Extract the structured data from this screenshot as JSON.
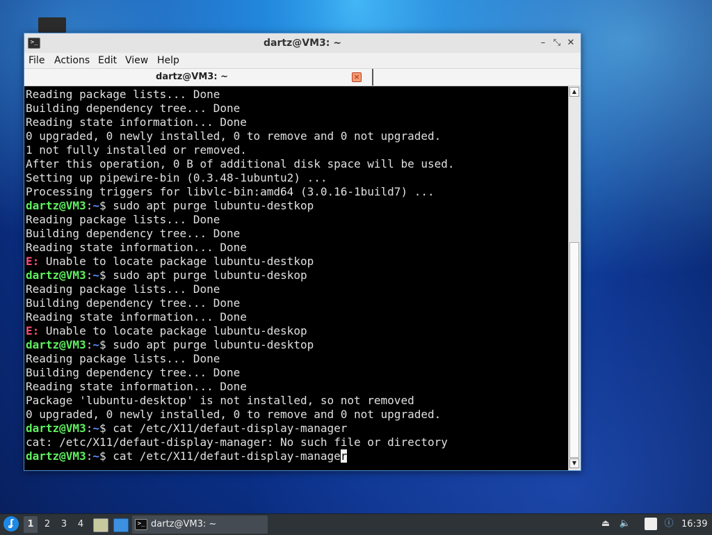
{
  "window": {
    "title": "dartz@VM3: ~",
    "minimize": "–",
    "maximize": "⤡",
    "close": "✕"
  },
  "menu": [
    "File",
    "Actions",
    "Edit",
    "View",
    "Help"
  ],
  "tab": {
    "label": "dartz@VM3: ~",
    "close": "×"
  },
  "terminal": {
    "lines": [
      {
        "type": "out",
        "text": "Reading package lists... Done"
      },
      {
        "type": "out",
        "text": "Building dependency tree... Done"
      },
      {
        "type": "out",
        "text": "Reading state information... Done"
      },
      {
        "type": "out",
        "text": "0 upgraded, 0 newly installed, 0 to remove and 0 not upgraded."
      },
      {
        "type": "out",
        "text": "1 not fully installed or removed."
      },
      {
        "type": "out",
        "text": "After this operation, 0 B of additional disk space will be used."
      },
      {
        "type": "out",
        "text": "Setting up pipewire-bin (0.3.48-1ubuntu2) ..."
      },
      {
        "type": "out",
        "text": "Processing triggers for libvlc-bin:amd64 (3.0.16-1build7) ..."
      },
      {
        "type": "cmd",
        "user": "dartz@VM3",
        "sep": ":",
        "path": "~",
        "sym": "$ ",
        "text": "sudo apt purge lubuntu-destkop"
      },
      {
        "type": "out",
        "text": "Reading package lists... Done"
      },
      {
        "type": "out",
        "text": "Building dependency tree... Done"
      },
      {
        "type": "out",
        "text": "Reading state information... Done"
      },
      {
        "type": "err",
        "prefix": "E:",
        "text": " Unable to locate package lubuntu-destkop"
      },
      {
        "type": "cmd",
        "user": "dartz@VM3",
        "sep": ":",
        "path": "~",
        "sym": "$ ",
        "text": "sudo apt purge lubuntu-deskop"
      },
      {
        "type": "out",
        "text": "Reading package lists... Done"
      },
      {
        "type": "out",
        "text": "Building dependency tree... Done"
      },
      {
        "type": "out",
        "text": "Reading state information... Done"
      },
      {
        "type": "err",
        "prefix": "E:",
        "text": " Unable to locate package lubuntu-deskop"
      },
      {
        "type": "cmd",
        "user": "dartz@VM3",
        "sep": ":",
        "path": "~",
        "sym": "$ ",
        "text": "sudo apt purge lubuntu-desktop"
      },
      {
        "type": "out",
        "text": "Reading package lists... Done"
      },
      {
        "type": "out",
        "text": "Building dependency tree... Done"
      },
      {
        "type": "out",
        "text": "Reading state information... Done"
      },
      {
        "type": "out",
        "text": "Package 'lubuntu-desktop' is not installed, so not removed"
      },
      {
        "type": "out",
        "text": "0 upgraded, 0 newly installed, 0 to remove and 0 not upgraded."
      },
      {
        "type": "cmd",
        "user": "dartz@VM3",
        "sep": ":",
        "path": "~",
        "sym": "$ ",
        "text": "cat /etc/X11/defaut-display-manager"
      },
      {
        "type": "out",
        "text": "cat: /etc/X11/defaut-display-manager: No such file or directory"
      },
      {
        "type": "cmd",
        "user": "dartz@VM3",
        "sep": ":",
        "path": "~",
        "sym": "$ ",
        "text": "cat /etc/X11/defaut-display-manage",
        "cursor": "r"
      }
    ]
  },
  "taskbar": {
    "desktops": [
      "1",
      "2",
      "3",
      "4"
    ],
    "task_label": "dartz@VM3: ~",
    "clock": "16:39"
  },
  "icons": {
    "start": "lubuntu-logo-icon",
    "terminal": "terminal-icon"
  }
}
